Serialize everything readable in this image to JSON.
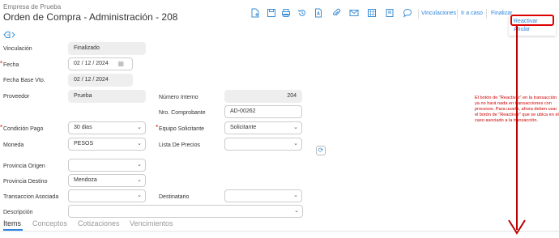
{
  "header": {
    "company": "Empresa de Prueba",
    "title": "Orden de Compra - Administración - 208"
  },
  "toolbar": {
    "icons": [
      "new-document-icon",
      "save-icon",
      "print-icon",
      "history-icon",
      "pdf-icon",
      "attachment-icon",
      "email-icon",
      "grid-icon",
      "notes-icon",
      "comments-icon"
    ],
    "links": {
      "vinculaciones": "Vinculaciones",
      "ir_a_caso": "Ir a caso",
      "finalizar": "Finalizar"
    }
  },
  "dropdown": {
    "reactivar": "Reactivar",
    "anular": "Anular"
  },
  "form": {
    "vinculacion": {
      "label": "Vinculación",
      "value": "Finalizado"
    },
    "fecha": {
      "label": "Fecha",
      "value": "02 / 12 / 2024"
    },
    "fecha_base_vto": {
      "label": "Fecha Base Vto.",
      "value": "02 / 12 / 2024"
    },
    "proveedor": {
      "label": "Proveedor",
      "value": "Prueba"
    },
    "numero_interno": {
      "label": "Número Interno",
      "value": "204"
    },
    "nro_comprobante": {
      "label": "Nro. Comprobante",
      "value": "AD-00262"
    },
    "condicion_pago": {
      "label": "Condición Pago",
      "value": "30 dias"
    },
    "equipo_solicitante": {
      "label": "Equipo Solicitante",
      "value": "Solicitante"
    },
    "moneda": {
      "label": "Moneda",
      "value": "PESOS"
    },
    "lista_precios": {
      "label": "Lista De Precios",
      "value": ""
    },
    "provincia_origen": {
      "label": "Provincia Origen",
      "value": ""
    },
    "provincia_destino": {
      "label": "Provincia Destino",
      "value": "Mendoza"
    },
    "transaccion_asociada": {
      "label": "Transaccion Asociada",
      "value": ""
    },
    "destinatario": {
      "label": "Destinatario",
      "value": ""
    },
    "descripcion": {
      "label": "Descripción",
      "value": ""
    }
  },
  "tabs": [
    "Items",
    "Conceptos",
    "Cotizaciones",
    "Vencimientos"
  ],
  "annotation": "El botón de \"Reactivar\" en la transacción ya no hará nada en transacciones con procesos. Para usarlo, ahora deben usar el botón de \"Reactivar\" que se ubica en el caso asociado a la transacción.",
  "colors": {
    "accent": "#2e86de",
    "annotation": "#cc0000",
    "readonly_field": "#eeeeee"
  }
}
